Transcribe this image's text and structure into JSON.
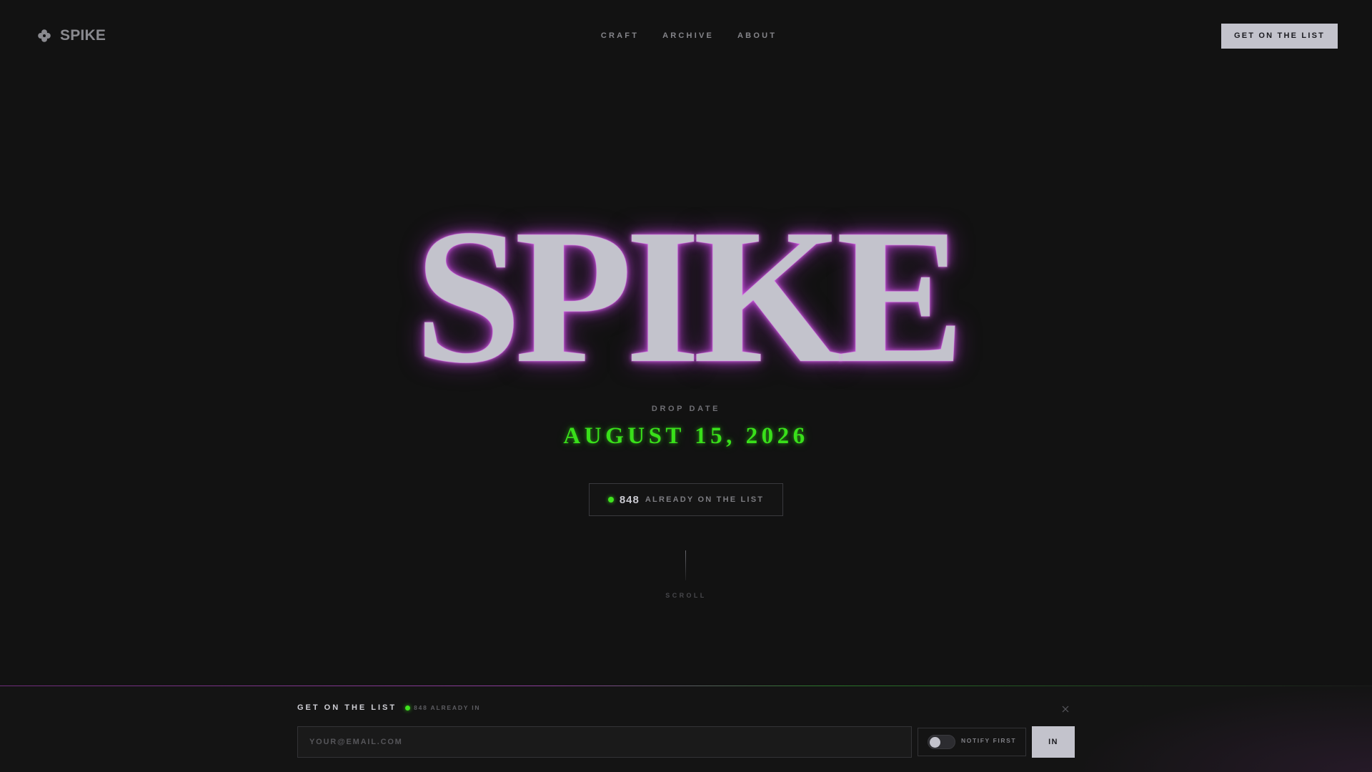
{
  "header": {
    "brand_icon": "clover-icon",
    "brand_name": "SPIKE",
    "nav": [
      {
        "label": "CRAFT"
      },
      {
        "label": "ARCHIVE"
      },
      {
        "label": "ABOUT"
      }
    ],
    "cta_label": "GET ON THE LIST"
  },
  "hero": {
    "title": "SPIKE",
    "drop_label": "DROP DATE",
    "drop_date": "AUGUST 15, 2026",
    "count": {
      "number": "848",
      "text": "ALREADY ON THE LIST"
    },
    "scroll_label": "SCROLL"
  },
  "signup_bar": {
    "title": "GET ON THE LIST",
    "subtitle": "848 ALREADY IN",
    "close_icon": "close-icon",
    "email_placeholder": "YOUR@EMAIL.COM",
    "email_value": "",
    "notify_label": "NOTIFY FIRST",
    "notify_on": false,
    "submit_label": "IN"
  },
  "colors": {
    "background": "#121212",
    "glow_purple": "#c046d7",
    "accent_green": "#39e01a",
    "button_bg": "#c3c3cc"
  }
}
